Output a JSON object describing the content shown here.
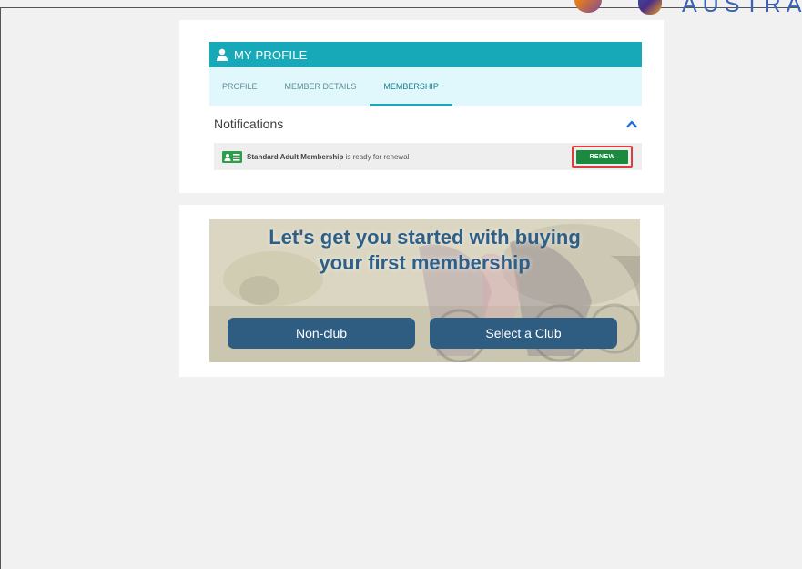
{
  "logo": {
    "text": "AUSTRA"
  },
  "profile": {
    "header_title": "MY PROFILE",
    "tabs": [
      {
        "label": "PROFILE",
        "active": false
      },
      {
        "label": "MEMBER DETAILS",
        "active": false
      },
      {
        "label": "MEMBERSHIP",
        "active": true
      }
    ],
    "notifications_title": "Notifications",
    "notification": {
      "membership_name": "Standard Adult Membership",
      "message": " is ready for renewal",
      "renew_label": "RENEW"
    }
  },
  "banner": {
    "title_line1": "Let's get you started with buying",
    "title_line2": "your first membership",
    "buttons": {
      "non_club": "Non-club",
      "select_club": "Select a Club"
    }
  },
  "colors": {
    "header_teal": "#17a9b7",
    "tab_bar": "#e0f8fb",
    "renew_green": "#1a8a3e",
    "highlight_red": "#e13b3b",
    "banner_button": "#2f5d82",
    "banner_title": "#2f5f86"
  }
}
